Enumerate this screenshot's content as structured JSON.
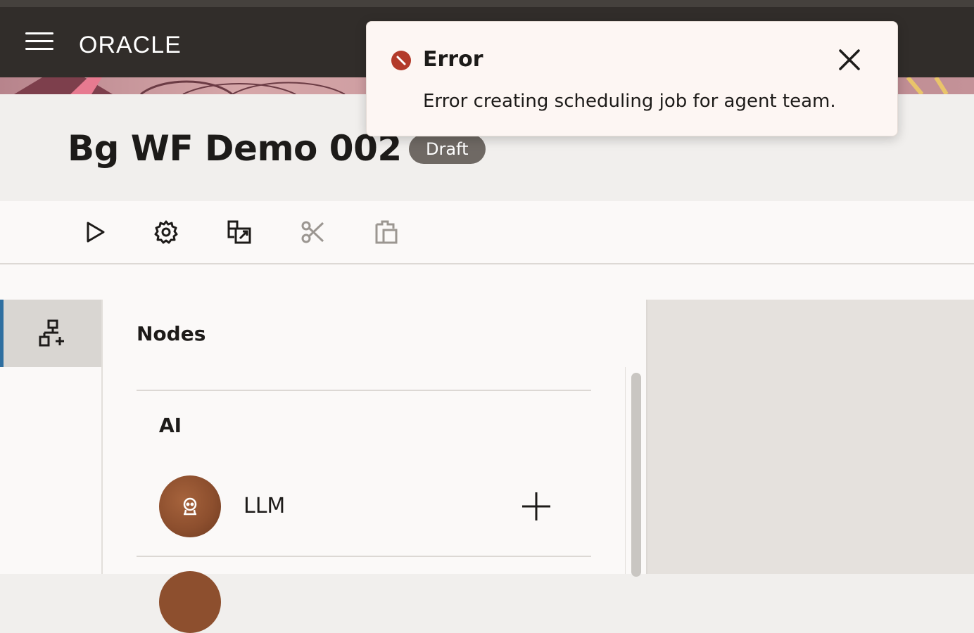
{
  "app": {
    "brand": "ORACLE"
  },
  "header": {
    "title": "Bg WF Demo 002",
    "status": "Draft"
  },
  "toolbar": {
    "items": [
      {
        "icon": "play-icon",
        "enabled": true
      },
      {
        "icon": "gear-icon",
        "enabled": true
      },
      {
        "icon": "export-icon",
        "enabled": true
      },
      {
        "icon": "scissors-icon",
        "enabled": false
      },
      {
        "icon": "paste-icon",
        "enabled": false
      }
    ]
  },
  "rail": {
    "active_icon": "add-node-icon"
  },
  "panel": {
    "title": "Nodes",
    "sections": [
      {
        "title": "AI",
        "items": [
          {
            "label": "LLM",
            "icon": "robot-icon",
            "action_icon": "plus-icon"
          }
        ]
      }
    ]
  },
  "toast": {
    "title": "Error",
    "message": "Error creating scheduling job for agent team.",
    "icon": "error-icon",
    "close_icon": "close-icon",
    "accent": "#b33a2a"
  },
  "colors": {
    "topbar": "#312d2a",
    "accent": "#2f6fa0",
    "badge": "#6f6964"
  }
}
